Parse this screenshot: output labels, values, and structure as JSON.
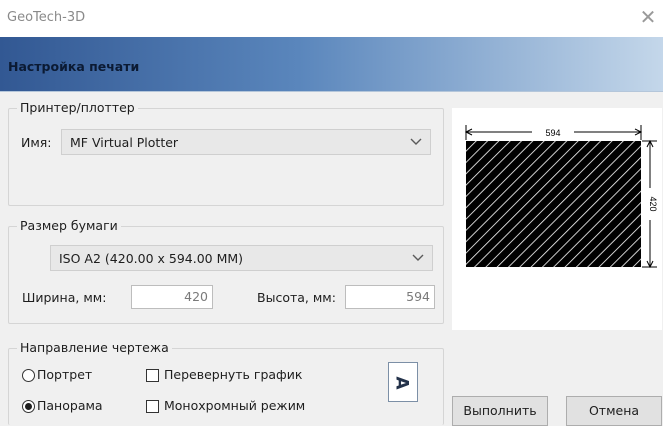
{
  "window": {
    "title": "GeoTech-3D",
    "close_glyph": "✕"
  },
  "header": {
    "title": "Настройка печати"
  },
  "printer": {
    "legend": "Принтер/плоттер",
    "name_label": "Имя:",
    "selected": "MF Virtual Plotter"
  },
  "paper": {
    "legend": "Размер бумаги",
    "selected": "ISO A2 (420.00 x 594.00 MM)",
    "width_label": "Ширина, мм:",
    "width_value": "420",
    "height_label": "Высота, мм:",
    "height_value": "594"
  },
  "orientation": {
    "legend": "Направление чертежа",
    "portrait": "Портрет",
    "landscape": "Панорама",
    "portrait_selected": false,
    "landscape_selected": true,
    "flip": "Перевернуть график",
    "mono": "Монохромный режим",
    "orient_glyph": "A"
  },
  "preview": {
    "width_label": "594",
    "height_label": "420"
  },
  "buttons": {
    "ok": "Выполнить",
    "cancel": "Отмена"
  },
  "colors": {
    "header_start": "#325893",
    "header_end": "#c4d7ea"
  },
  "icons": {
    "close": "close-icon",
    "dropdown": "chevron-down-icon",
    "orientation": "orientation-icon"
  }
}
